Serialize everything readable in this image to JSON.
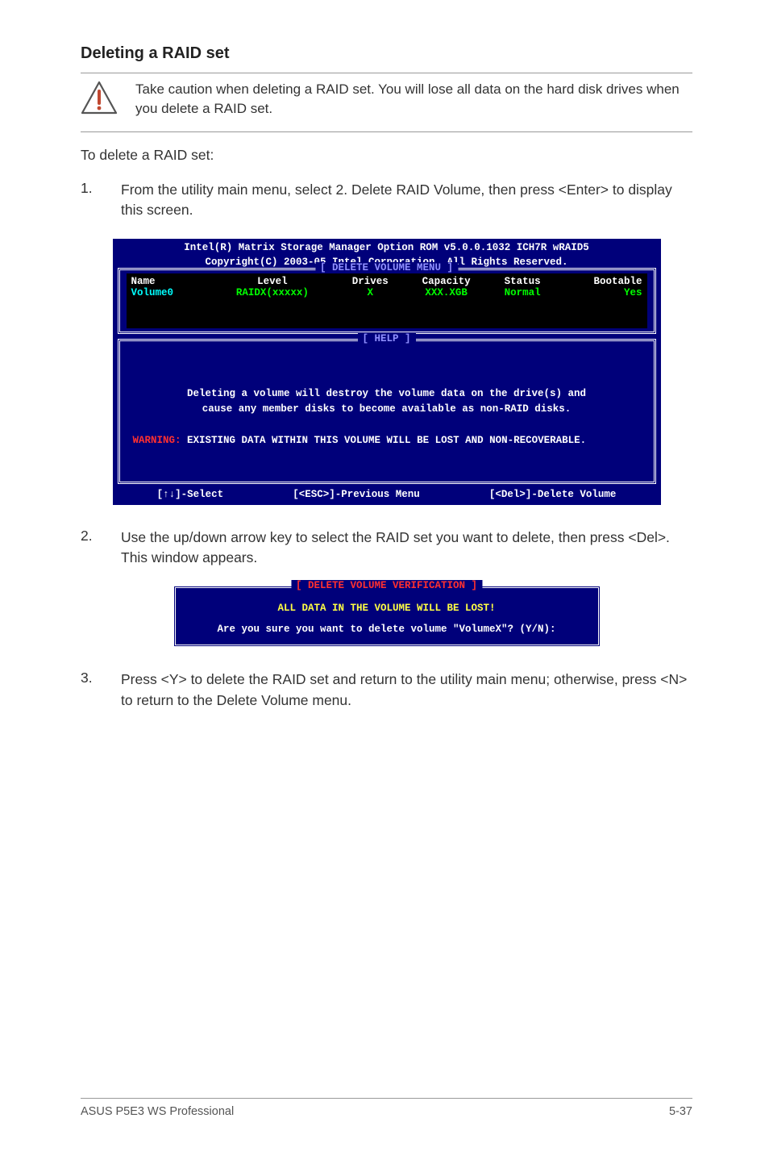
{
  "heading": "Deleting a RAID set",
  "caution_text": "Take caution when deleting a RAID set. You will lose all data on the hard disk drives when you delete a RAID set.",
  "intro": "To delete a RAID set:",
  "steps": [
    {
      "num": "1.",
      "text": "From the utility main menu, select 2. Delete RAID Volume, then press <Enter> to display this screen."
    },
    {
      "num": "2.",
      "text": "Use the up/down arrow key to select the RAID set you want to delete, then press <Del>. This window appears."
    },
    {
      "num": "3.",
      "text": "Press <Y> to delete the RAID set and return to the utility main menu; otherwise, press <N> to return to the Delete Volume menu."
    }
  ],
  "bios": {
    "title1": "Intel(R) Matrix Storage Manager Option ROM v5.0.0.1032 ICH7R wRAID5",
    "title2": "Copyright(C) 2003-05 Intel Corporation. All Rights Reserved.",
    "section_delete": "[ DELETE VOLUME MENU ]",
    "section_help": "[ HELP ]",
    "columns": [
      "Name",
      "Level",
      "Drives",
      "Capacity",
      "Status",
      "Bootable"
    ],
    "row": {
      "name": "Volume0",
      "level": "RAIDX(xxxxx)",
      "drives": "X",
      "capacity": "XXX.XGB",
      "status": "Normal",
      "bootable": "Yes"
    },
    "help1": "Deleting a volume will destroy the volume data on the drive(s) and",
    "help2": "cause any member disks to become available as non-RAID disks.",
    "warn_label": "WARNING:",
    "warn_text": " EXISTING DATA WITHIN THIS VOLUME WILL BE LOST AND NON-RECOVERABLE.",
    "footer": {
      "select": "[↑↓]-Select",
      "prev": "[<ESC>]-Previous Menu",
      "del": "[<Del>]-Delete Volume"
    }
  },
  "dialog": {
    "title": "[ DELETE VOLUME VERIFICATION ]",
    "line1": "ALL DATA IN THE VOLUME WILL BE LOST!",
    "line2": "Are you sure you want to delete volume \"VolumeX\"? (Y/N):"
  },
  "footer": {
    "left": "ASUS P5E3 WS Professional",
    "right": "5-37"
  }
}
